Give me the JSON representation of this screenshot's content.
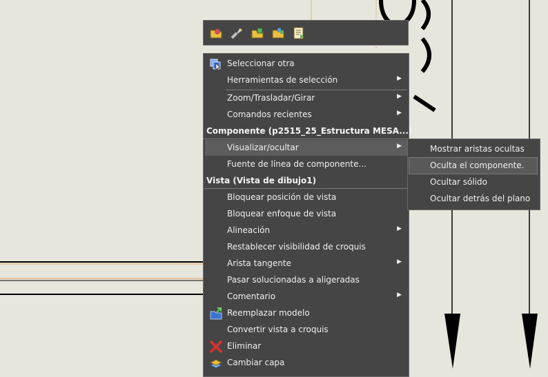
{
  "toolbar": {
    "icons": [
      "open-drawing-icon",
      "flashlight-icon",
      "open-part-icon",
      "open-assembly-icon",
      "part-properties-icon"
    ]
  },
  "menu": {
    "items": [
      {
        "type": "item",
        "label": "Seleccionar otra",
        "icon": "select-other-icon"
      },
      {
        "type": "item",
        "label": "Herramientas de selección",
        "submenu": true
      },
      {
        "type": "item",
        "label": "Zoom/Trasladar/Girar",
        "submenu": true
      },
      {
        "type": "item",
        "label": "Comandos recientes",
        "submenu": true
      },
      {
        "type": "section",
        "label": "Componente (p2515_25_Estructura MESA...)"
      },
      {
        "type": "item",
        "label": "Visualizar/ocultar",
        "submenu": true,
        "highlighted": true
      },
      {
        "type": "item",
        "label": "Fuente de línea de componente..."
      },
      {
        "type": "section",
        "label": "Vista (Vista de dibujo1)"
      },
      {
        "type": "item",
        "label": "Bloquear posición de vista"
      },
      {
        "type": "item",
        "label": "Bloquear enfoque de vista"
      },
      {
        "type": "item",
        "label": "Alineación",
        "submenu": true
      },
      {
        "type": "item",
        "label": "Restablecer visibilidad de croquis"
      },
      {
        "type": "item",
        "label": "Arista tangente",
        "submenu": true
      },
      {
        "type": "item",
        "label": "Pasar solucionadas a aligeradas"
      },
      {
        "type": "item",
        "label": "Comentario",
        "submenu": true
      },
      {
        "type": "item",
        "label": "Reemplazar modelo",
        "icon": "replace-model-icon"
      },
      {
        "type": "item",
        "label": "Convertir vista a croquis"
      },
      {
        "type": "item",
        "label": "Eliminar",
        "icon": "delete-icon"
      },
      {
        "type": "item",
        "label": "Cambiar capa",
        "icon": "change-layer-icon"
      }
    ]
  },
  "submenu": {
    "items": [
      {
        "label": "Mostrar aristas ocultas"
      },
      {
        "label": "Oculta el componente.",
        "highlighted": true
      },
      {
        "label": "Ocultar sólido"
      },
      {
        "label": "Ocultar detrás del plano"
      }
    ]
  }
}
